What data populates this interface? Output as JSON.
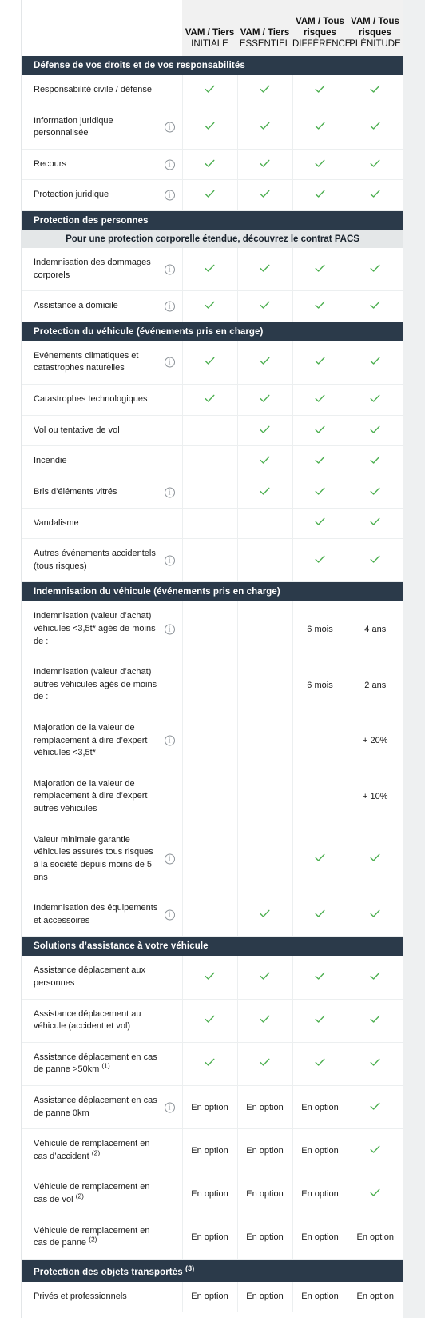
{
  "columns": [
    {
      "top": "VAM / Tiers",
      "sub": "INITIALE"
    },
    {
      "top": "VAM / Tiers",
      "sub": "ESSENTIEL"
    },
    {
      "top": "VAM / Tous risques",
      "sub": "DIFFÉRENCE"
    },
    {
      "top": "VAM / Tous risques",
      "sub": "PLÉNITUDE"
    }
  ],
  "colors": {
    "section_band": "#2b3a4a",
    "sub_band": "#e4e7e8",
    "header_cell": "#f1f1f1",
    "check_green": "#4caf50",
    "grid_line": "#eceff0"
  },
  "icons": {
    "info": "info-icon",
    "check": "check-icon"
  },
  "sections": [
    {
      "title": "Défense de vos droits et de vos responsabilités",
      "rows": [
        {
          "label": "Responsabilité civile / défense",
          "info": false,
          "values": [
            "check",
            "check",
            "check",
            "check"
          ]
        },
        {
          "label": "Information juridique personnalisée",
          "info": true,
          "values": [
            "check",
            "check",
            "check",
            "check"
          ]
        },
        {
          "label": "Recours",
          "info": true,
          "values": [
            "check",
            "check",
            "check",
            "check"
          ]
        },
        {
          "label": "Protection juridique",
          "info": true,
          "values": [
            "check",
            "check",
            "check",
            "check"
          ]
        }
      ]
    },
    {
      "title": "Protection des personnes",
      "subband": "Pour une protection corporelle étendue, découvrez le contrat PACS",
      "rows": [
        {
          "label": "Indemnisation des dommages corporels",
          "info": true,
          "values": [
            "check",
            "check",
            "check",
            "check"
          ]
        },
        {
          "label": "Assistance à domicile",
          "info": true,
          "values": [
            "check",
            "check",
            "check",
            "check"
          ]
        }
      ]
    },
    {
      "title": "Protection du véhicule (événements pris en charge)",
      "rows": [
        {
          "label": "Evénements climatiques et catastrophes naturelles",
          "info": true,
          "values": [
            "check",
            "check",
            "check",
            "check"
          ]
        },
        {
          "label": "Catastrophes technologiques",
          "info": false,
          "values": [
            "check",
            "check",
            "check",
            "check"
          ]
        },
        {
          "label": "Vol ou tentative de vol",
          "info": false,
          "values": [
            "",
            "check",
            "check",
            "check"
          ]
        },
        {
          "label": "Incendie",
          "info": false,
          "values": [
            "",
            "check",
            "check",
            "check"
          ]
        },
        {
          "label": "Bris d’éléments vitrés",
          "info": true,
          "values": [
            "",
            "check",
            "check",
            "check"
          ]
        },
        {
          "label": "Vandalisme",
          "info": false,
          "values": [
            "",
            "",
            "check",
            "check"
          ]
        },
        {
          "label": "Autres événements accidentels (tous risques)",
          "info": true,
          "values": [
            "",
            "",
            "check",
            "check"
          ]
        }
      ]
    },
    {
      "title": "Indemnisation du véhicule (événements pris en charge)",
      "rows": [
        {
          "label": "Indemnisation (valeur d’achat) véhicules <3,5t* agés de moins de :",
          "info": true,
          "values": [
            "",
            "",
            "6 mois",
            "4 ans"
          ]
        },
        {
          "label": "Indemnisation (valeur d’achat) autres véhicules agés de moins de :",
          "info": false,
          "values": [
            "",
            "",
            "6 mois",
            "2 ans"
          ]
        },
        {
          "label": "Majoration de la valeur de remplacement à dire d’expert véhicules <3,5t*",
          "info": true,
          "values": [
            "",
            "",
            "",
            "+ 20%"
          ]
        },
        {
          "label": "Majoration de la valeur de remplacement à dire d’expert autres véhicules",
          "info": false,
          "values": [
            "",
            "",
            "",
            "+ 10%"
          ]
        },
        {
          "label": "Valeur minimale garantie véhicules assurés tous risques à la société depuis moins de 5 ans",
          "info": true,
          "values": [
            "",
            "",
            "check",
            "check"
          ]
        },
        {
          "label": "Indemnisation des équipements et accessoires",
          "info": true,
          "values": [
            "",
            "check",
            "check",
            "check"
          ]
        }
      ]
    },
    {
      "title": "Solutions d’assistance à votre véhicule",
      "rows": [
        {
          "label": "Assistance déplacement aux personnes",
          "info": false,
          "values": [
            "check",
            "check",
            "check",
            "check"
          ]
        },
        {
          "label": "Assistance déplacement au véhicule (accident et vol)",
          "info": false,
          "values": [
            "check",
            "check",
            "check",
            "check"
          ]
        },
        {
          "label": "Assistance déplacement en cas de panne >50km",
          "footnote": "(1)",
          "info": false,
          "values": [
            "check",
            "check",
            "check",
            "check"
          ]
        },
        {
          "label": "Assistance déplacement en cas de panne 0km",
          "info": true,
          "values": [
            "En option",
            "En option",
            "En option",
            "check"
          ]
        },
        {
          "label": "Véhicule de remplacement en cas d’accident",
          "footnote": "(2)",
          "info": false,
          "values": [
            "En option",
            "En option",
            "En option",
            "check"
          ]
        },
        {
          "label": "Véhicule de remplacement en cas de vol",
          "footnote": "(2)",
          "info": false,
          "values": [
            "En option",
            "En option",
            "En option",
            "check"
          ]
        },
        {
          "label": "Véhicule de remplacement en cas de panne",
          "footnote": "(2)",
          "info": false,
          "values": [
            "En option",
            "En option",
            "En option",
            "En option"
          ]
        }
      ]
    },
    {
      "title": "Protection des objets transportés",
      "title_footnote": "(3)",
      "rows": [
        {
          "label": "Privés et professionnels",
          "info": false,
          "values": [
            "En option",
            "En option",
            "En option",
            "En option"
          ]
        }
      ]
    }
  ]
}
